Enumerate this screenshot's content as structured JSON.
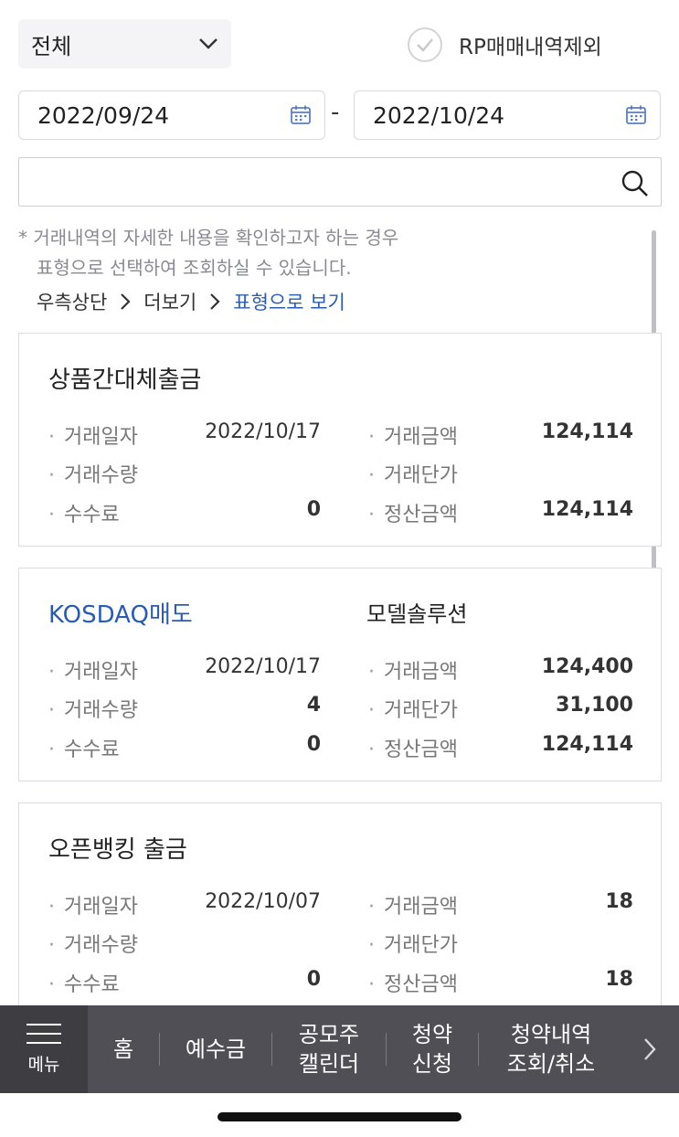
{
  "filter": {
    "select_value": "전체",
    "rp_checkbox_label": "RP매매내역제외",
    "date_from": "2022/09/24",
    "date_separator": "-",
    "date_to": "2022/10/24",
    "search_value": ""
  },
  "notice": {
    "line1": "* 거래내역의 자세한 내용을 확인하고자 하는 경우",
    "line2": "표형으로 선택하여 조회하실 수 있습니다."
  },
  "breadcrumb": {
    "step1": "우측상단",
    "step2": "더보기",
    "step3": "표형으로 보기"
  },
  "labels": {
    "trade_date": "거래일자",
    "trade_qty": "거래수량",
    "fee": "수수료",
    "trade_amount": "거래금액",
    "unit_price": "거래단가",
    "settle_amount": "정산금액"
  },
  "transactions": [
    {
      "title": "상품간대체출금",
      "stock": "",
      "trade_date": "2022/10/17",
      "trade_qty": "",
      "fee": "0",
      "trade_amount": "124,114",
      "unit_price": "",
      "settle_amount": "124,114"
    },
    {
      "title": "KOSDAQ매도",
      "stock": "모델솔루션",
      "trade_date": "2022/10/17",
      "trade_qty": "4",
      "fee": "0",
      "trade_amount": "124,400",
      "unit_price": "31,100",
      "settle_amount": "124,114"
    },
    {
      "title": "오픈뱅킹 출금",
      "stock": "",
      "trade_date": "2022/10/07",
      "trade_qty": "",
      "fee": "0",
      "trade_amount": "18",
      "unit_price": "",
      "settle_amount": "18"
    }
  ],
  "bottom_nav": {
    "menu": "메뉴",
    "home": "홈",
    "deposit": "예수금",
    "ipo_calendar_1": "공모주",
    "ipo_calendar_2": "캘린더",
    "subscribe_1": "청약",
    "subscribe_2": "신청",
    "subscribe_history_1": "청약내역",
    "subscribe_history_2": "조회/취소"
  },
  "colors": {
    "accent_blue": "#2b5cad",
    "nav_bg": "#4f4f55",
    "menu_bg": "#3d3d42"
  }
}
